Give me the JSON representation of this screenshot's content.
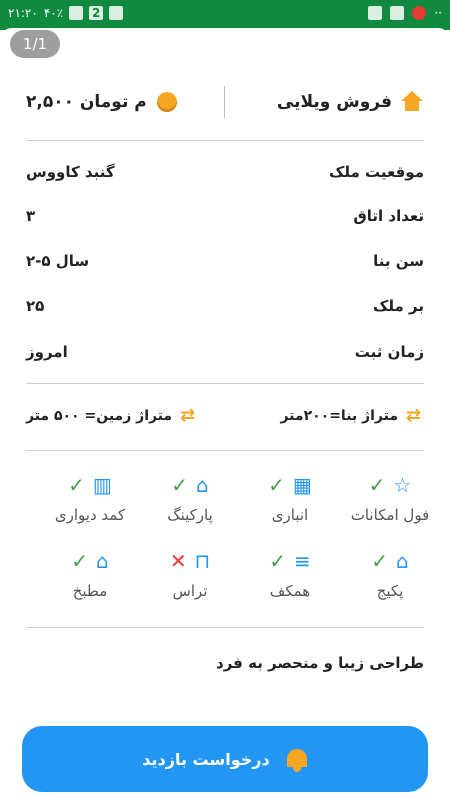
{
  "status": {
    "time": "۲۱:۲۰",
    "battery": "۴۰٪",
    "notif_count": "2"
  },
  "page_indicator": "1/1",
  "title": {
    "type_label": "فروش ویلایی",
    "price": "۲,۵۰۰ م تومان"
  },
  "details": [
    {
      "label": "موقعیت ملک",
      "value": "گنبد کاووس"
    },
    {
      "label": "تعداد اتاق",
      "value": "۳"
    },
    {
      "label": "سن بنا",
      "value": "۲-۵ سال"
    },
    {
      "label": "بر ملک",
      "value": "۲۵"
    },
    {
      "label": "زمان ثبت",
      "value": "امروز"
    }
  ],
  "area": {
    "building": "متراژ بنا=۲۰۰متر",
    "land": "متراژ زمین= ۵۰۰ متر"
  },
  "features": [
    {
      "label": "فول امکانات",
      "available": true,
      "icon": "star-icon"
    },
    {
      "label": "انباری",
      "available": true,
      "icon": "storage-icon"
    },
    {
      "label": "پارکینگ",
      "available": true,
      "icon": "car-icon"
    },
    {
      "label": "کمد دیواری",
      "available": true,
      "icon": "closet-icon"
    },
    {
      "label": "پکیج",
      "available": true,
      "icon": "house-heater-icon"
    },
    {
      "label": "همکف",
      "available": true,
      "icon": "floor-icon"
    },
    {
      "label": "تراس",
      "available": false,
      "icon": "terrace-icon"
    },
    {
      "label": "مطبخ",
      "available": true,
      "icon": "kitchen-icon"
    }
  ],
  "description": "طراحی زیبا و منحصر به فرد",
  "cta_label": "درخواست بازدید",
  "colors": {
    "accent": "#2196f3",
    "orange": "#f5a623",
    "ok": "#43a047",
    "no": "#e53935"
  }
}
